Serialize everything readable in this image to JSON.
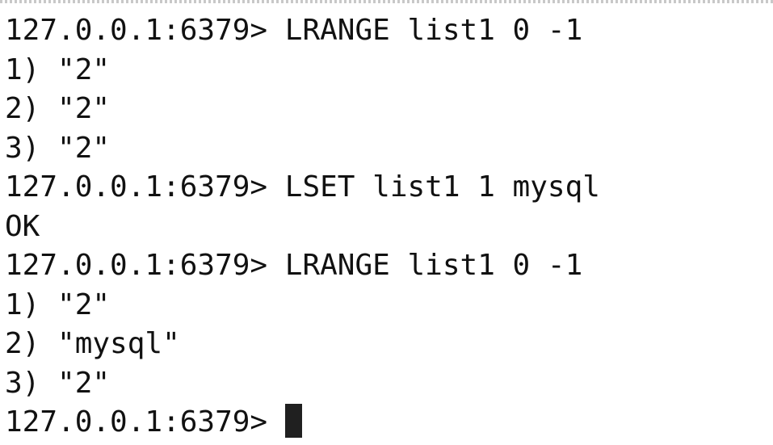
{
  "terminal": {
    "lines": [
      "127.0.0.1:6379> LRANGE list1 0 -1",
      "1) \"2\"",
      "2) \"2\"",
      "3) \"2\"",
      "127.0.0.1:6379> LSET list1 1 mysql",
      "OK",
      "127.0.0.1:6379> LRANGE list1 0 -1",
      "1) \"2\"",
      "2) \"mysql\"",
      "3) \"2\""
    ],
    "prompt": "127.0.0.1:6379> "
  }
}
